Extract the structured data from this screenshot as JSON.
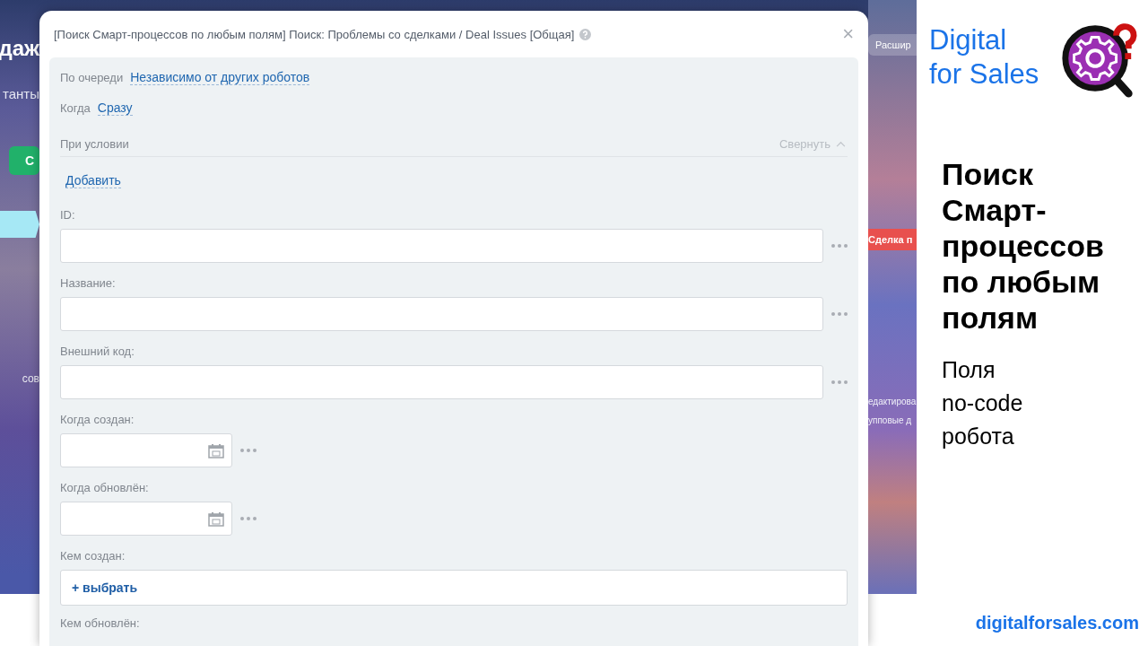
{
  "background": {
    "left_items": [
      {
        "kind": "heading",
        "text": "даж"
      },
      {
        "kind": "plain",
        "text": "танты"
      },
      {
        "kind": "green-button",
        "text": "С"
      },
      {
        "kind": "arrow-tab"
      },
      {
        "kind": "small",
        "text": "сов"
      }
    ],
    "right_items": [
      {
        "kind": "glass-button",
        "text": "Расшир"
      },
      {
        "kind": "red-tag",
        "text": "Сделка п"
      },
      {
        "kind": "small",
        "text": "едактирова"
      },
      {
        "kind": "small",
        "text": "упповые д"
      }
    ]
  },
  "dialog": {
    "title": "[Поиск Смарт-процессов по любым полям] Поиск: Проблемы со сделками / Deal Issues [Общая]",
    "close": "×",
    "settings": [
      {
        "label": "По очереди",
        "value": "Независимо от других роботов"
      },
      {
        "label": "Когда",
        "value": "Сразу"
      }
    ],
    "condition": {
      "label": "При условии",
      "collapse": "Свернуть",
      "add": "Добавить"
    },
    "fields": [
      {
        "kind": "text",
        "label": "ID:"
      },
      {
        "kind": "text",
        "label": "Название:"
      },
      {
        "kind": "text",
        "label": "Внешний код:"
      },
      {
        "kind": "date",
        "label": "Когда создан:"
      },
      {
        "kind": "date",
        "label": "Когда обновлён:"
      },
      {
        "kind": "user",
        "label": "Кем создан:",
        "action": "+ выбрать"
      },
      {
        "kind": "label-only",
        "label": "Кем обновлён:"
      }
    ]
  },
  "promo": {
    "brand": [
      "Digital",
      "for Sales"
    ],
    "heading": "Поиск Смарт-процессов по любым полям",
    "subtitle": [
      "Поля",
      "no-code",
      "робота"
    ],
    "link": "digitalforsales.com"
  }
}
